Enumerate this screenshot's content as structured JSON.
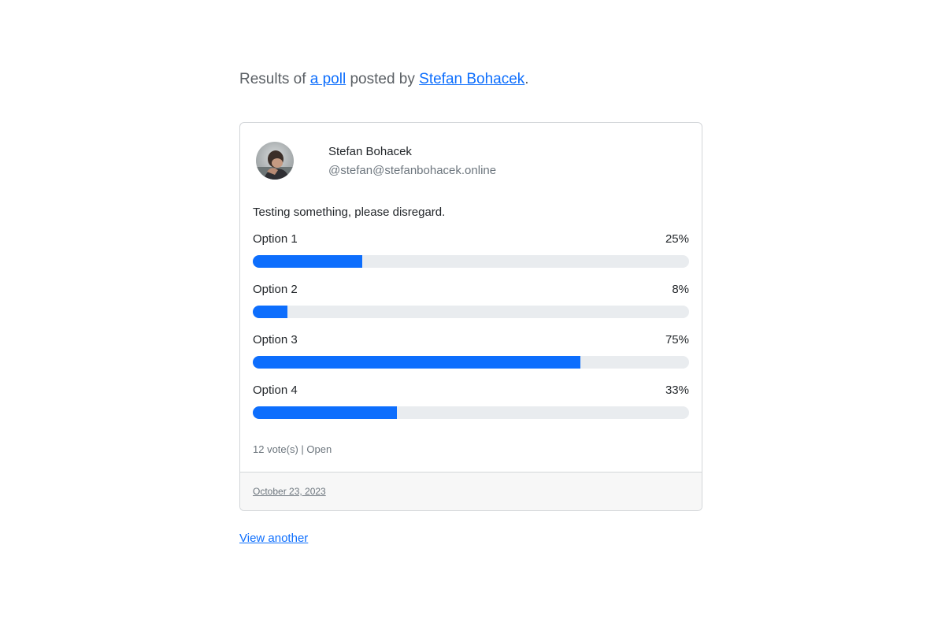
{
  "header": {
    "prefix": "Results of ",
    "poll_link": "a poll",
    "middle": " posted by ",
    "author_link": "Stefan Bohacek",
    "suffix": "."
  },
  "post": {
    "author_name": "Stefan Bohacek",
    "author_handle": "@stefan@stefanbohacek.online",
    "text": "Testing something, please disregard."
  },
  "poll": {
    "options": [
      {
        "label": "Option 1",
        "percent_label": "25%",
        "percent": 25
      },
      {
        "label": "Option 2",
        "percent_label": "8%",
        "percent": 8
      },
      {
        "label": "Option 3",
        "percent_label": "75%",
        "percent": 75
      },
      {
        "label": "Option 4",
        "percent_label": "33%",
        "percent": 33
      }
    ],
    "summary": "12 vote(s) | Open"
  },
  "footer": {
    "date": "October 23, 2023"
  },
  "links": {
    "view_another": "View another"
  },
  "colors": {
    "accent": "#0d6efd",
    "track": "#e9ecef"
  }
}
